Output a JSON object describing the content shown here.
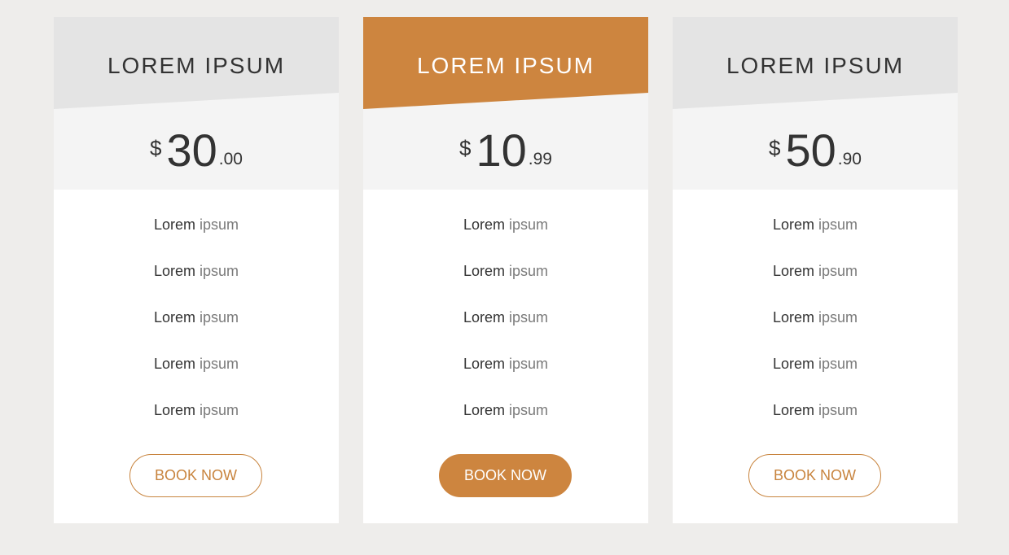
{
  "colors": {
    "accent": "#cd853f",
    "page_background": "#eeedeb",
    "header_gray": "#e4e4e4",
    "price_band": "#f4f4f4"
  },
  "plans": [
    {
      "title": "LOREM IPSUM",
      "currency": "$",
      "amount": "30",
      "cents": ".00",
      "features": [
        {
          "strong": "Lorem",
          "muted": "ipsum"
        },
        {
          "strong": "Lorem",
          "muted": "ipsum"
        },
        {
          "strong": "Lorem",
          "muted": "ipsum"
        },
        {
          "strong": "Lorem",
          "muted": "ipsum"
        },
        {
          "strong": "Lorem",
          "muted": "ipsum"
        }
      ],
      "button_label": "BOOK NOW"
    },
    {
      "title": "LOREM IPSUM",
      "currency": "$",
      "amount": "10",
      "cents": ".99",
      "features": [
        {
          "strong": "Lorem",
          "muted": "ipsum"
        },
        {
          "strong": "Lorem",
          "muted": "ipsum"
        },
        {
          "strong": "Lorem",
          "muted": "ipsum"
        },
        {
          "strong": "Lorem",
          "muted": "ipsum"
        },
        {
          "strong": "Lorem",
          "muted": "ipsum"
        }
      ],
      "button_label": "BOOK NOW"
    },
    {
      "title": "LOREM IPSUM",
      "currency": "$",
      "amount": "50",
      "cents": ".90",
      "features": [
        {
          "strong": "Lorem",
          "muted": "ipsum"
        },
        {
          "strong": "Lorem",
          "muted": "ipsum"
        },
        {
          "strong": "Lorem",
          "muted": "ipsum"
        },
        {
          "strong": "Lorem",
          "muted": "ipsum"
        },
        {
          "strong": "Lorem",
          "muted": "ipsum"
        }
      ],
      "button_label": "BOOK NOW"
    }
  ]
}
